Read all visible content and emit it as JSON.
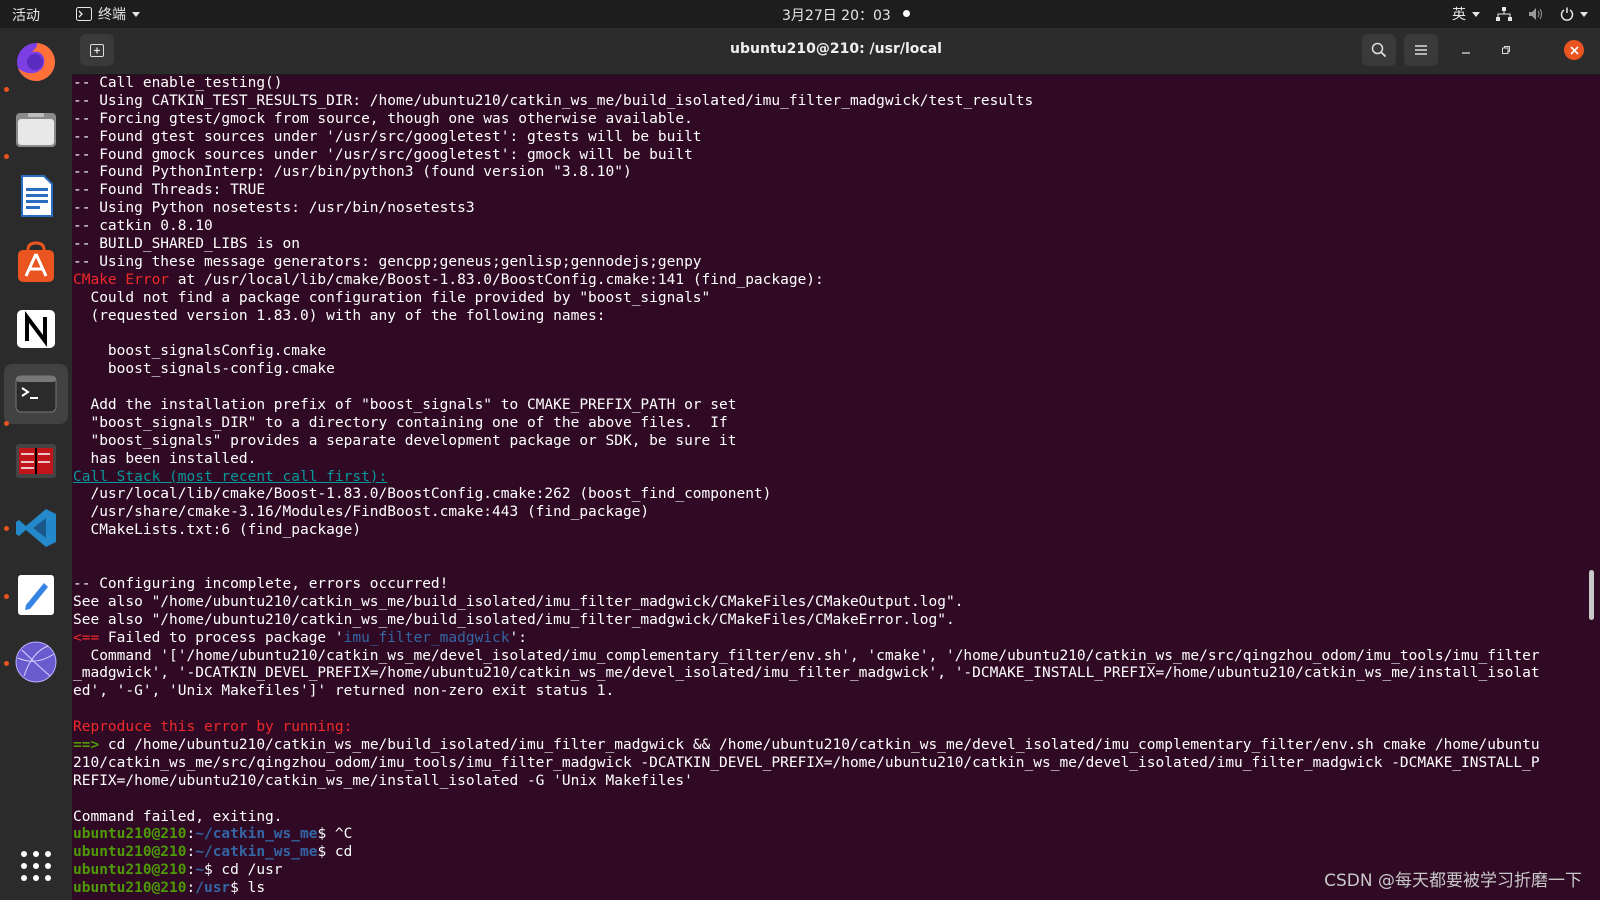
{
  "topbar": {
    "activities": "活动",
    "app_menu": "终端",
    "clock": "3月27日 20：03",
    "input_method": "英"
  },
  "dock": {
    "items": [
      "firefox-icon",
      "files-icon",
      "writer-icon",
      "app-center-icon",
      "notion-icon",
      "terminal-icon",
      "system-monitor-icon",
      "vscode-icon",
      "text-editor-icon",
      "network-app-icon",
      "show-apps-icon"
    ]
  },
  "window": {
    "title": "ubuntu210@210: /usr/local"
  },
  "terminal": {
    "lines": [
      [
        {
          "t": "-- Call enable_testing()"
        }
      ],
      [
        {
          "t": "-- Using CATKIN_TEST_RESULTS_DIR: /home/ubuntu210/catkin_ws_me/build_isolated/imu_filter_madgwick/test_results"
        }
      ],
      [
        {
          "t": "-- Forcing gtest/gmock from source, though one was otherwise available."
        }
      ],
      [
        {
          "t": "-- Found gtest sources under '/usr/src/googletest': gtests will be built"
        }
      ],
      [
        {
          "t": "-- Found gmock sources under '/usr/src/googletest': gmock will be built"
        }
      ],
      [
        {
          "t": "-- Found PythonInterp: /usr/bin/python3 (found version \"3.8.10\")"
        }
      ],
      [
        {
          "t": "-- Found Threads: TRUE"
        }
      ],
      [
        {
          "t": "-- Using Python nosetests: /usr/bin/nosetests3"
        }
      ],
      [
        {
          "t": "-- catkin 0.8.10"
        }
      ],
      [
        {
          "t": "-- BUILD_SHARED_LIBS is on"
        }
      ],
      [
        {
          "t": "-- Using these message generators: gencpp;geneus;genlisp;gennodejs;genpy"
        }
      ],
      [
        {
          "t": "CMake Error",
          "c": "red"
        },
        {
          "t": " at /usr/local/lib/cmake/Boost-1.83.0/BoostConfig.cmake:141 (find_package):"
        }
      ],
      [
        {
          "t": "  Could not find a package configuration file provided by \"boost_signals\""
        }
      ],
      [
        {
          "t": "  (requested version 1.83.0) with any of the following names:"
        }
      ],
      [
        {
          "t": ""
        }
      ],
      [
        {
          "t": "    boost_signalsConfig.cmake"
        }
      ],
      [
        {
          "t": "    boost_signals-config.cmake"
        }
      ],
      [
        {
          "t": ""
        }
      ],
      [
        {
          "t": "  Add the installation prefix of \"boost_signals\" to CMAKE_PREFIX_PATH or set"
        }
      ],
      [
        {
          "t": "  \"boost_signals_DIR\" to a directory containing one of the above files.  If"
        }
      ],
      [
        {
          "t": "  \"boost_signals\" provides a separate development package or SDK, be sure it"
        }
      ],
      [
        {
          "t": "  has been installed."
        }
      ],
      [
        {
          "t": "Call Stack (most recent call first):",
          "c": "link"
        }
      ],
      [
        {
          "t": "  /usr/local/lib/cmake/Boost-1.83.0/BoostConfig.cmake:262 (boost_find_component)"
        }
      ],
      [
        {
          "t": "  /usr/share/cmake-3.16/Modules/FindBoost.cmake:443 (find_package)"
        }
      ],
      [
        {
          "t": "  CMakeLists.txt:6 (find_package)"
        }
      ],
      [
        {
          "t": ""
        }
      ],
      [
        {
          "t": ""
        }
      ],
      [
        {
          "t": "-- Configuring incomplete, errors occurred!"
        }
      ],
      [
        {
          "t": "See also \"/home/ubuntu210/catkin_ws_me/build_isolated/imu_filter_madgwick/CMakeFiles/CMakeOutput.log\"."
        }
      ],
      [
        {
          "t": "See also \"/home/ubuntu210/catkin_ws_me/build_isolated/imu_filter_madgwick/CMakeFiles/CMakeError.log\"."
        }
      ],
      [
        {
          "t": "<== ",
          "c": "red"
        },
        {
          "t": "Failed to process package '"
        },
        {
          "t": "imu_filter_madgwick",
          "c": "blue"
        },
        {
          "t": "':"
        }
      ],
      [
        {
          "t": "  Command '['/home/ubuntu210/catkin_ws_me/devel_isolated/imu_complementary_filter/env.sh', 'cmake', '/home/ubuntu210/catkin_ws_me/src/qingzhou_odom/imu_tools/imu_filter"
        }
      ],
      [
        {
          "t": "_madgwick', '-DCATKIN_DEVEL_PREFIX=/home/ubuntu210/catkin_ws_me/devel_isolated/imu_filter_madgwick', '-DCMAKE_INSTALL_PREFIX=/home/ubuntu210/catkin_ws_me/install_isolat"
        }
      ],
      [
        {
          "t": "ed', '-G', 'Unix Makefiles']' returned non-zero exit status 1."
        }
      ],
      [
        {
          "t": ""
        }
      ],
      [
        {
          "t": "Reproduce this error by running:",
          "c": "red"
        }
      ],
      [
        {
          "t": "==> ",
          "c": "green"
        },
        {
          "t": "cd /home/ubuntu210/catkin_ws_me/build_isolated/imu_filter_madgwick && /home/ubuntu210/catkin_ws_me/devel_isolated/imu_complementary_filter/env.sh cmake /home/ubuntu"
        }
      ],
      [
        {
          "t": "210/catkin_ws_me/src/qingzhou_odom/imu_tools/imu_filter_madgwick -DCATKIN_DEVEL_PREFIX=/home/ubuntu210/catkin_ws_me/devel_isolated/imu_filter_madgwick -DCMAKE_INSTALL_P"
        }
      ],
      [
        {
          "t": "REFIX=/home/ubuntu210/catkin_ws_me/install_isolated -G 'Unix Makefiles'"
        }
      ],
      [
        {
          "t": ""
        }
      ],
      [
        {
          "t": "Command failed, exiting."
        }
      ],
      [
        {
          "t": "ubuntu210@210",
          "c": "green"
        },
        {
          "t": ":"
        },
        {
          "t": "~/catkin_ws_me",
          "c": "bluebold"
        },
        {
          "t": "$ ^C"
        }
      ],
      [
        {
          "t": "ubuntu210@210",
          "c": "green"
        },
        {
          "t": ":"
        },
        {
          "t": "~/catkin_ws_me",
          "c": "bluebold"
        },
        {
          "t": "$ cd"
        }
      ],
      [
        {
          "t": "ubuntu210@210",
          "c": "green"
        },
        {
          "t": ":"
        },
        {
          "t": "~",
          "c": "bluebold"
        },
        {
          "t": "$ cd /usr"
        }
      ],
      [
        {
          "t": "ubuntu210@210",
          "c": "green"
        },
        {
          "t": ":"
        },
        {
          "t": "/usr",
          "c": "bluebold"
        },
        {
          "t": "$ ls"
        }
      ]
    ]
  },
  "watermark": "CSDN @每天都要被学习折磨一下"
}
